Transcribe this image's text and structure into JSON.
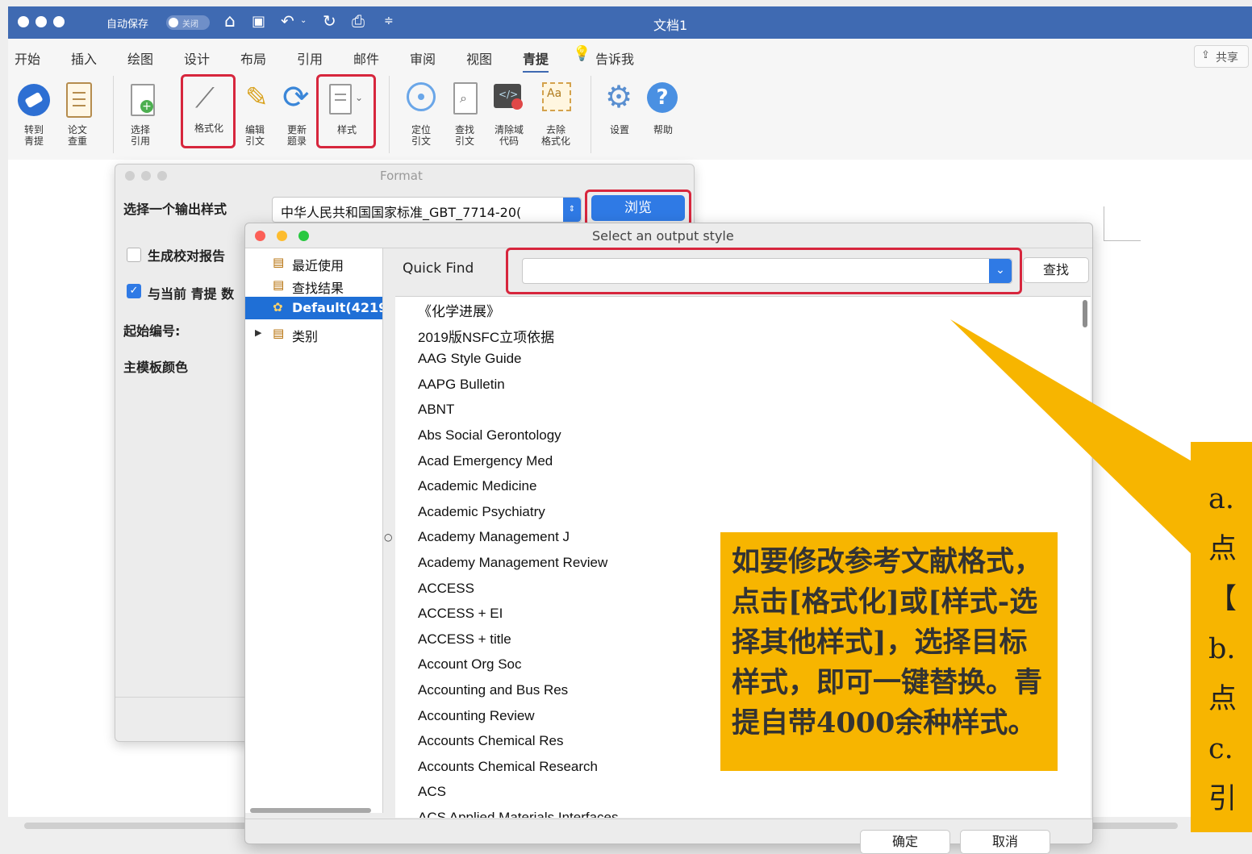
{
  "titlebar": {
    "autosave_label": "自动保存",
    "autosave_toggle": "关闭",
    "doc_title": "文档1"
  },
  "menu": {
    "items": [
      "开始",
      "插入",
      "绘图",
      "设计",
      "布局",
      "引用",
      "邮件",
      "审阅",
      "视图",
      "青提"
    ],
    "active_item": "青提",
    "tell_me": "告诉我",
    "share": "共享"
  },
  "ribbon": {
    "buttons": [
      {
        "label": "转到\n青提",
        "icon": "qingti-logo-icon"
      },
      {
        "label": "论文\n查重",
        "icon": "clipboard-icon"
      },
      {
        "label": "选择\n引用",
        "icon": "add-doc-icon"
      },
      {
        "label": "格式化",
        "icon": "magic-wand-icon"
      },
      {
        "label": "编辑\n引文",
        "icon": "pencil-icon"
      },
      {
        "label": "更新\n题录",
        "icon": "refresh-icon"
      },
      {
        "label": "样式",
        "icon": "style-doc-icon"
      },
      {
        "label": "定位\n引文",
        "icon": "locate-icon"
      },
      {
        "label": "查找\n引文",
        "icon": "find-doc-icon"
      },
      {
        "label": "清除域\n代码",
        "icon": "clear-code-icon"
      },
      {
        "label": "去除\n格式化",
        "icon": "remove-format-icon"
      },
      {
        "label": "设置",
        "icon": "gear-icon"
      },
      {
        "label": "帮助",
        "icon": "help-icon"
      }
    ]
  },
  "format_dialog": {
    "title": "Format",
    "output_style_label": "选择一个输出样式",
    "output_style_value": "中华人民共和国国家标准_GBT_7714-20(",
    "browse_button": "浏览",
    "generate_report_label": "生成校对报告",
    "sync_label": "与当前 青提 数",
    "start_number_label": "起始编号:",
    "template_color_label": "主模板颜色"
  },
  "select_dialog": {
    "title": "Select an output style",
    "tree": [
      {
        "label": "最近使用"
      },
      {
        "label": "查找结果"
      },
      {
        "label": "Default(4219"
      },
      {
        "label": "类别"
      }
    ],
    "quick_find_label": "Quick Find",
    "quick_find_value": "",
    "find_button": "查找",
    "styles": [
      "《化学进展》",
      "2019版NSFC立项依据",
      "AAG Style Guide",
      "AAPG Bulletin",
      "ABNT",
      "Abs Social Gerontology",
      "Acad Emergency Med",
      "Academic Medicine",
      "Academic Psychiatry",
      "Academy Management J",
      "Academy Management Review",
      "ACCESS",
      "ACCESS + EI",
      "ACCESS + title",
      "Account Org Soc",
      "Accounting and Bus Res",
      "Accounting Review",
      "Accounts Chemical Res",
      "Accounts Chemical Research",
      "ACS",
      "ACS Applied Materials Interfaces"
    ],
    "ok_button": "确定",
    "cancel_button": "取消"
  },
  "callout_text": "如要修改参考文献格式，点击[格式化]或[样式-选择其他样式]，选择目标样式，即可一键替换。青提自带4000余种样式。",
  "side_note_lines": [
    "a.",
    "点",
    "【",
    "b.",
    "点",
    "c.",
    "引"
  ],
  "colors": {
    "titlebar": "#3f6ab2",
    "highlight": "#d7263d",
    "callout": "#f7b500",
    "selection": "#1f6fd6"
  }
}
